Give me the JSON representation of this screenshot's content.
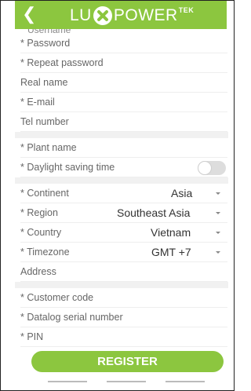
{
  "header": {
    "back_icon": "chevron-left-icon",
    "brand_left": "LU",
    "brand_right": "POWER",
    "brand_super": "TEK",
    "accent": "#8cc63f"
  },
  "form": {
    "cut_label": "Username",
    "password": "* Password",
    "repeat_password": "* Repeat password",
    "real_name": "Real name",
    "email": "* E-mail",
    "tel": "Tel number",
    "plant_name": "* Plant name",
    "daylight_saving": "* Daylight saving time",
    "daylight_saving_on": false,
    "continent_label": "* Continent",
    "continent_value": "Asia",
    "region_label": "* Region",
    "region_value": "Southeast Asia",
    "country_label": "* Country",
    "country_value": "Vietnam",
    "timezone_label": "* Timezone",
    "timezone_value": "GMT +7",
    "address": "Address",
    "customer_code": "* Customer code",
    "datalog_sn": "* Datalog serial number",
    "pin": "* PIN"
  },
  "actions": {
    "register": "REGISTER"
  }
}
